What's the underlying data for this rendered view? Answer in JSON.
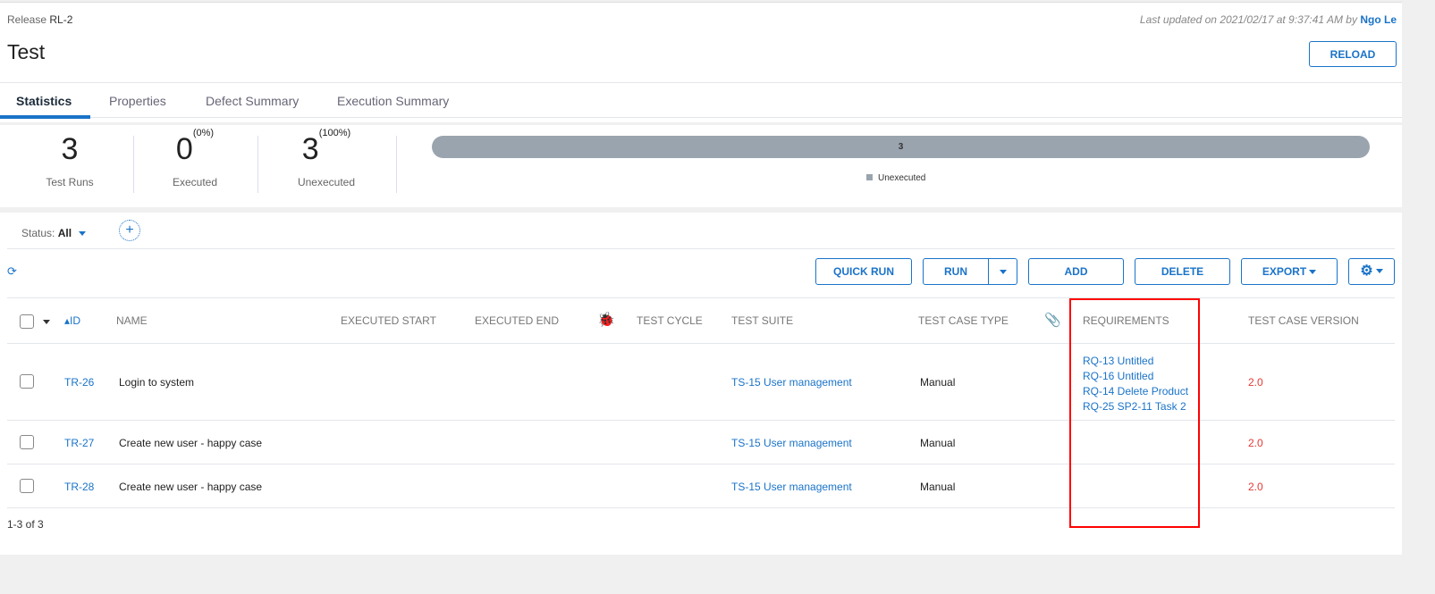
{
  "header": {
    "release_label": "Release",
    "release_id": "RL-2",
    "title": "Test",
    "updated_text": "Last updated on 2021/02/17 at 9:37:41 AM by",
    "updated_by": "Ngo Le",
    "reload": "RELOAD"
  },
  "tabs": [
    {
      "label": "Statistics"
    },
    {
      "label": "Properties"
    },
    {
      "label": "Defect Summary"
    },
    {
      "label": "Execution Summary"
    }
  ],
  "stats": {
    "test_runs": "3",
    "test_runs_label": "Test Runs",
    "executed": "0",
    "executed_pct": "(0%)",
    "executed_label": "Executed",
    "unexecuted": "3",
    "unexecuted_pct": "(100%)",
    "unexecuted_label": "Unexecuted",
    "bar_value": "3",
    "legend": "Unexecuted",
    "bar_color": "#9aa4ae"
  },
  "filter": {
    "label": "Status:",
    "value": "All"
  },
  "toolbar": {
    "quick_run": "QUICK RUN",
    "run": "RUN",
    "add": "ADD",
    "delete": "DELETE",
    "export": "EXPORT"
  },
  "columns": {
    "id": "ID",
    "name": "NAME",
    "exec_start": "EXECUTED START",
    "exec_end": "EXECUTED END",
    "test_cycle": "TEST CYCLE",
    "test_suite": "TEST SUITE",
    "type": "TEST CASE TYPE",
    "requirements": "REQUIREMENTS",
    "version": "TEST CASE VERSION"
  },
  "rows": [
    {
      "id": "TR-26",
      "name": "Login to system",
      "suite": "TS-15 User management",
      "type": "Manual",
      "reqs": [
        "RQ-13 Untitled",
        "RQ-16 Untitled",
        "RQ-14 Delete Product",
        "RQ-25 SP2-11 Task 2"
      ],
      "version": "2.0"
    },
    {
      "id": "TR-27",
      "name": "Create new user - happy case",
      "suite": "TS-15 User management",
      "type": "Manual",
      "reqs": [],
      "version": "2.0"
    },
    {
      "id": "TR-28",
      "name": "Create new user - happy case",
      "suite": "TS-15 User management",
      "type": "Manual",
      "reqs": [],
      "version": "2.0"
    }
  ],
  "footer": {
    "count": "1-3 of 3"
  }
}
